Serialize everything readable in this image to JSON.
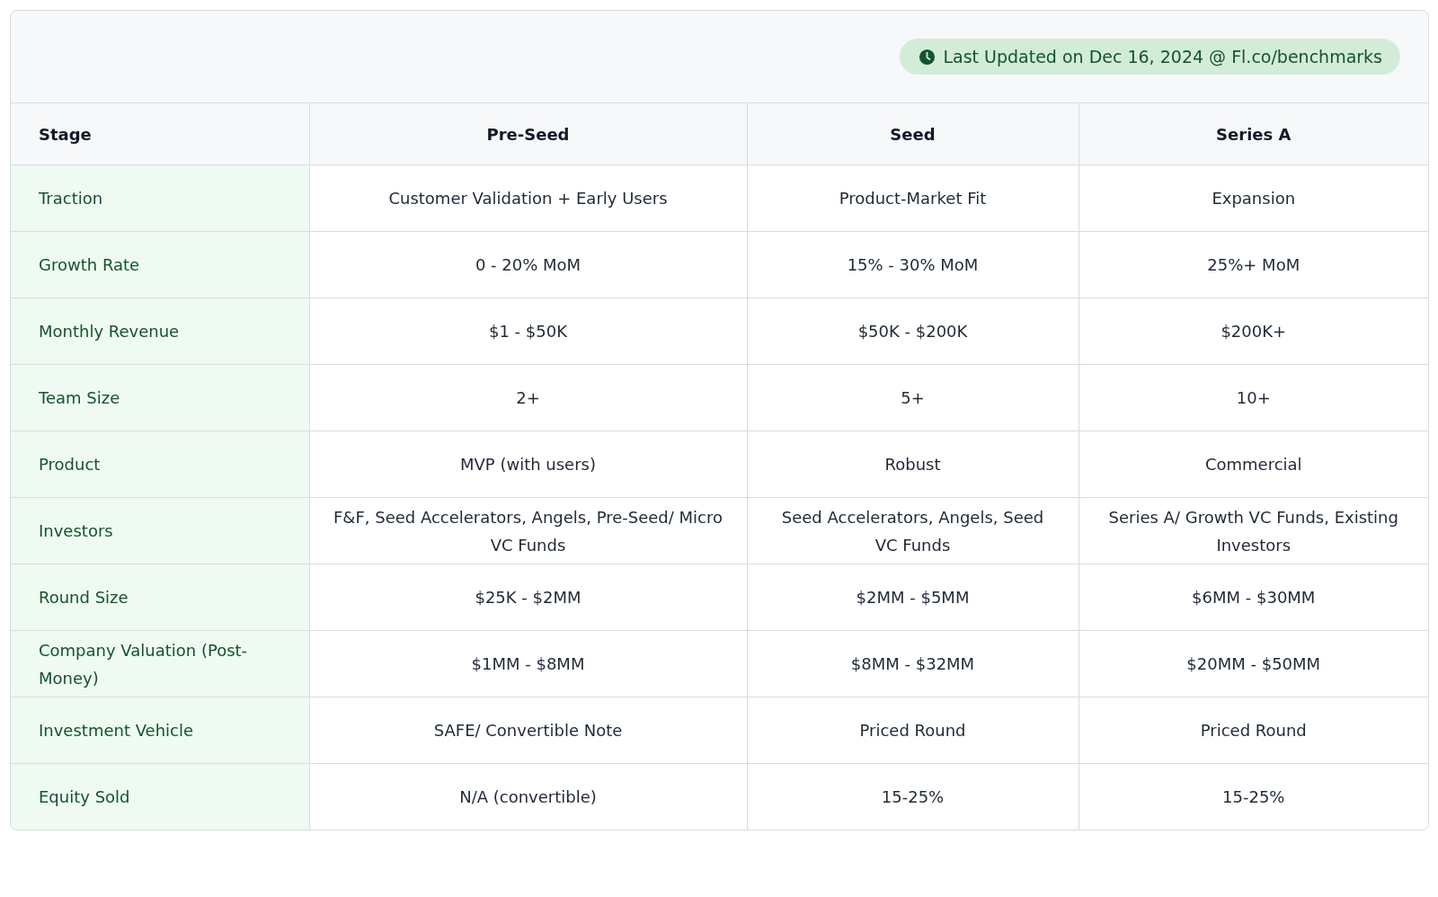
{
  "badge": {
    "text": "Last Updated on Dec 16, 2024 @ Fl.co/benchmarks"
  },
  "table": {
    "columns": [
      "Stage",
      "Pre-Seed",
      "Seed",
      "Series A"
    ],
    "rows": [
      [
        "Traction",
        "Customer Validation + Early Users",
        "Product-Market Fit",
        "Expansion"
      ],
      [
        "Growth Rate",
        "0 - 20% MoM",
        "15% - 30% MoM",
        "25%+ MoM"
      ],
      [
        "Monthly Revenue",
        "$1 - $50K",
        "$50K - $200K",
        "$200K+"
      ],
      [
        "Team Size",
        "2+",
        "5+",
        "10+"
      ],
      [
        "Product",
        "MVP (with users)",
        "Robust",
        "Commercial"
      ],
      [
        "Investors",
        "F&F, Seed Accelerators, Angels, Pre-Seed/ Micro VC Funds",
        "Seed Accelerators, Angels, Seed VC Funds",
        "Series A/ Growth VC Funds, Existing Investors"
      ],
      [
        "Round Size",
        "$25K - $2MM",
        "$2MM - $5MM",
        "$6MM - $30MM"
      ],
      [
        "Company Valuation (Post-Money)",
        "$1MM - $8MM",
        "$8MM - $32MM",
        "$20MM - $50MM"
      ],
      [
        "Investment Vehicle",
        "SAFE/ Convertible Note",
        "Priced Round",
        "Priced Round"
      ],
      [
        "Equity Sold",
        "N/A (convertible)",
        "15-25%",
        "15-25%"
      ]
    ]
  }
}
